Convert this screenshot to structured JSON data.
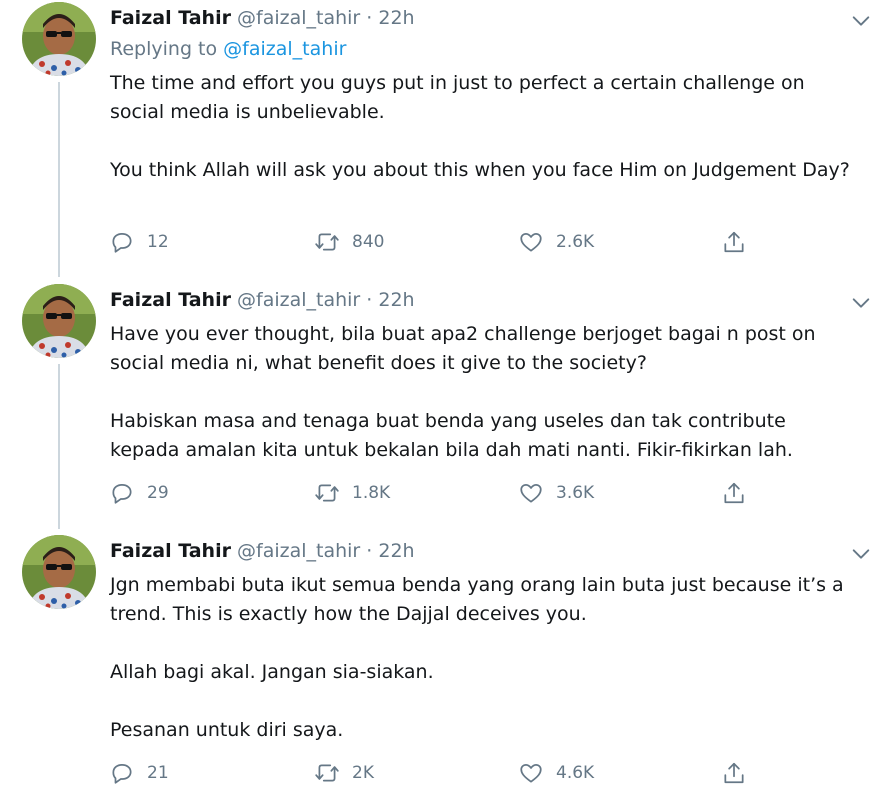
{
  "tweets": [
    {
      "name": "Faizal Tahir",
      "handle": "@faizal_tahir",
      "separator": "·",
      "time": "22h",
      "replying_prefix": "Replying to",
      "replying_to": "@faizal_tahir",
      "paragraphs": [
        "The time and effort you guys put in just to perfect a certain challenge on social media is unbelievable.",
        "You think Allah will ask you about this when you face Him on Judgement Day?"
      ],
      "replies": "12",
      "retweets": "840",
      "likes": "2.6K"
    },
    {
      "name": "Faizal Tahir",
      "handle": "@faizal_tahir",
      "separator": "·",
      "time": "22h",
      "paragraphs": [
        "Have you ever thought, bila buat apa2 challenge berjoget bagai n post on social media ni, what benefit does it give to the society?",
        "Habiskan masa and tenaga buat benda yang useles dan tak contribute kepada amalan kita untuk bekalan bila dah mati nanti. Fikir-fikirkan lah."
      ],
      "replies": "29",
      "retweets": "1.8K",
      "likes": "3.6K"
    },
    {
      "name": "Faizal Tahir",
      "handle": "@faizal_tahir",
      "separator": "·",
      "time": "22h",
      "paragraphs": [
        "Jgn membabi buta ikut semua benda yang orang lain buta just because it’s a trend. This is exactly how the Dajjal deceives you.",
        "Allah bagi akal. Jangan sia-siakan.",
        "Pesanan untuk diri saya."
      ],
      "replies": "21",
      "retweets": "2K",
      "likes": "4.6K"
    }
  ],
  "icons": {
    "reply": "reply-icon",
    "retweet": "retweet-icon",
    "like": "like-icon",
    "share": "share-icon",
    "menu": "chevron-down-icon"
  },
  "colors": {
    "text": "#14171a",
    "secondary": "#657786",
    "link": "#1b95e0",
    "thread_line": "#ccd6dd"
  }
}
